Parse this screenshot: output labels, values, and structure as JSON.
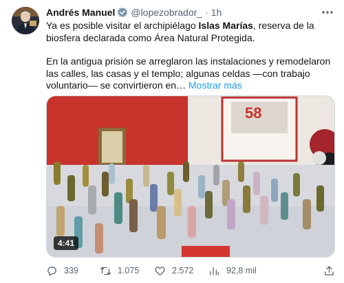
{
  "tweet": {
    "author_name": "Andrés Manuel",
    "handle": "@lopezobrador_",
    "separator": "·",
    "time": "1h",
    "body": {
      "p1_a": "Ya es posible visitar el archipiélago ",
      "p1_bold": "Islas Marías",
      "p1_b": ", reserva de la biosfera declarada como Área Natural Protegida.",
      "p2": "En la antigua prisión se arreglaron las instalaciones y remodelaron las calles, las casas y el templo; algunas celdas —con trabajo voluntario— se convirtieron en… ",
      "show_more": "Mostrar más"
    },
    "media": {
      "duration": "4:41",
      "sign_text": "58"
    },
    "actions": {
      "replies": "339",
      "retweets": "1.075",
      "likes": "2.572",
      "views": "92,8 mil"
    },
    "icons": {
      "verified": "verified-badge-icon",
      "more": "more-options-icon",
      "reply": "reply-icon",
      "retweet": "retweet-icon",
      "like": "heart-icon",
      "views": "views-chart-icon",
      "share": "share-icon"
    },
    "colors": {
      "accent": "#1d9bf0",
      "secondary_text": "#536471",
      "text": "#0f1419"
    }
  }
}
